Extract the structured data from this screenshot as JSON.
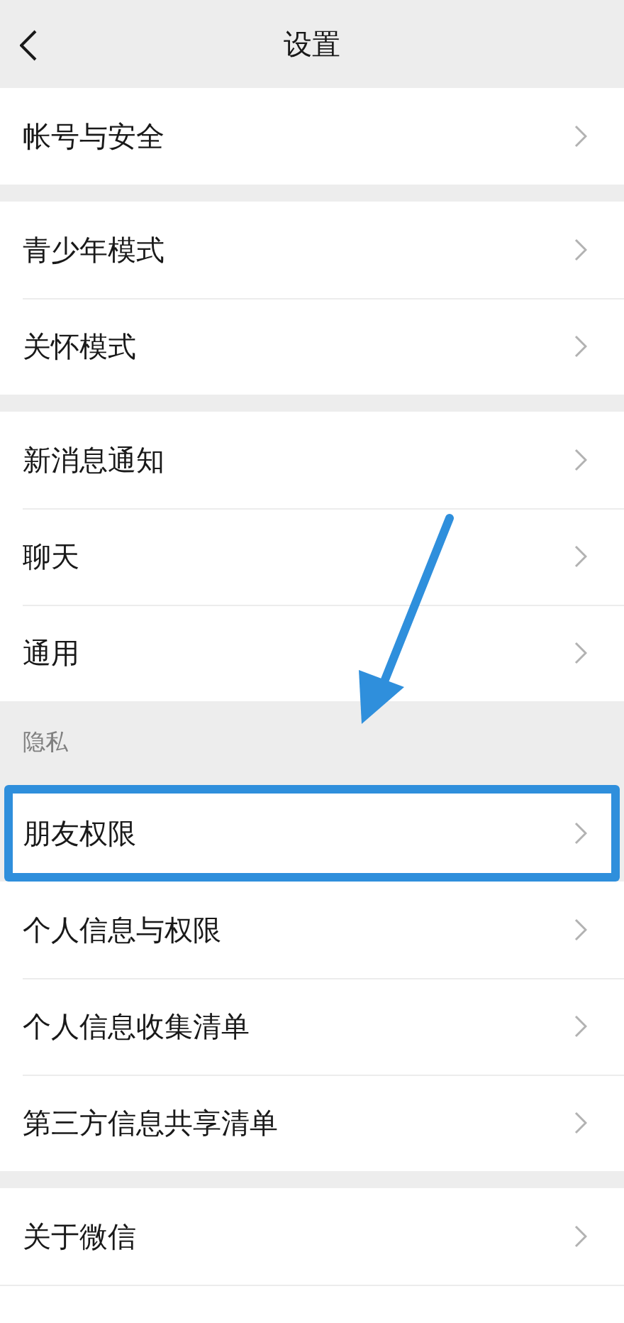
{
  "nav_bar": {
    "title": "设置"
  },
  "groups": [
    {
      "items": [
        {
          "label": "帐号与安全",
          "highlighted": false
        }
      ]
    },
    {
      "items": [
        {
          "label": "青少年模式",
          "highlighted": false
        },
        {
          "label": "关怀模式",
          "highlighted": false
        }
      ]
    },
    {
      "items": [
        {
          "label": "新消息通知",
          "highlighted": false
        },
        {
          "label": "聊天",
          "highlighted": false
        },
        {
          "label": "通用",
          "highlighted": false
        }
      ]
    },
    {
      "header": "隐私",
      "items": [
        {
          "label": "朋友权限",
          "highlighted": true
        },
        {
          "label": "个人信息与权限",
          "highlighted": false
        },
        {
          "label": "个人信息收集清单",
          "highlighted": false
        },
        {
          "label": "第三方信息共享清单",
          "highlighted": false
        }
      ]
    },
    {
      "items": [
        {
          "label": "关于微信",
          "highlighted": false
        }
      ]
    }
  ]
}
